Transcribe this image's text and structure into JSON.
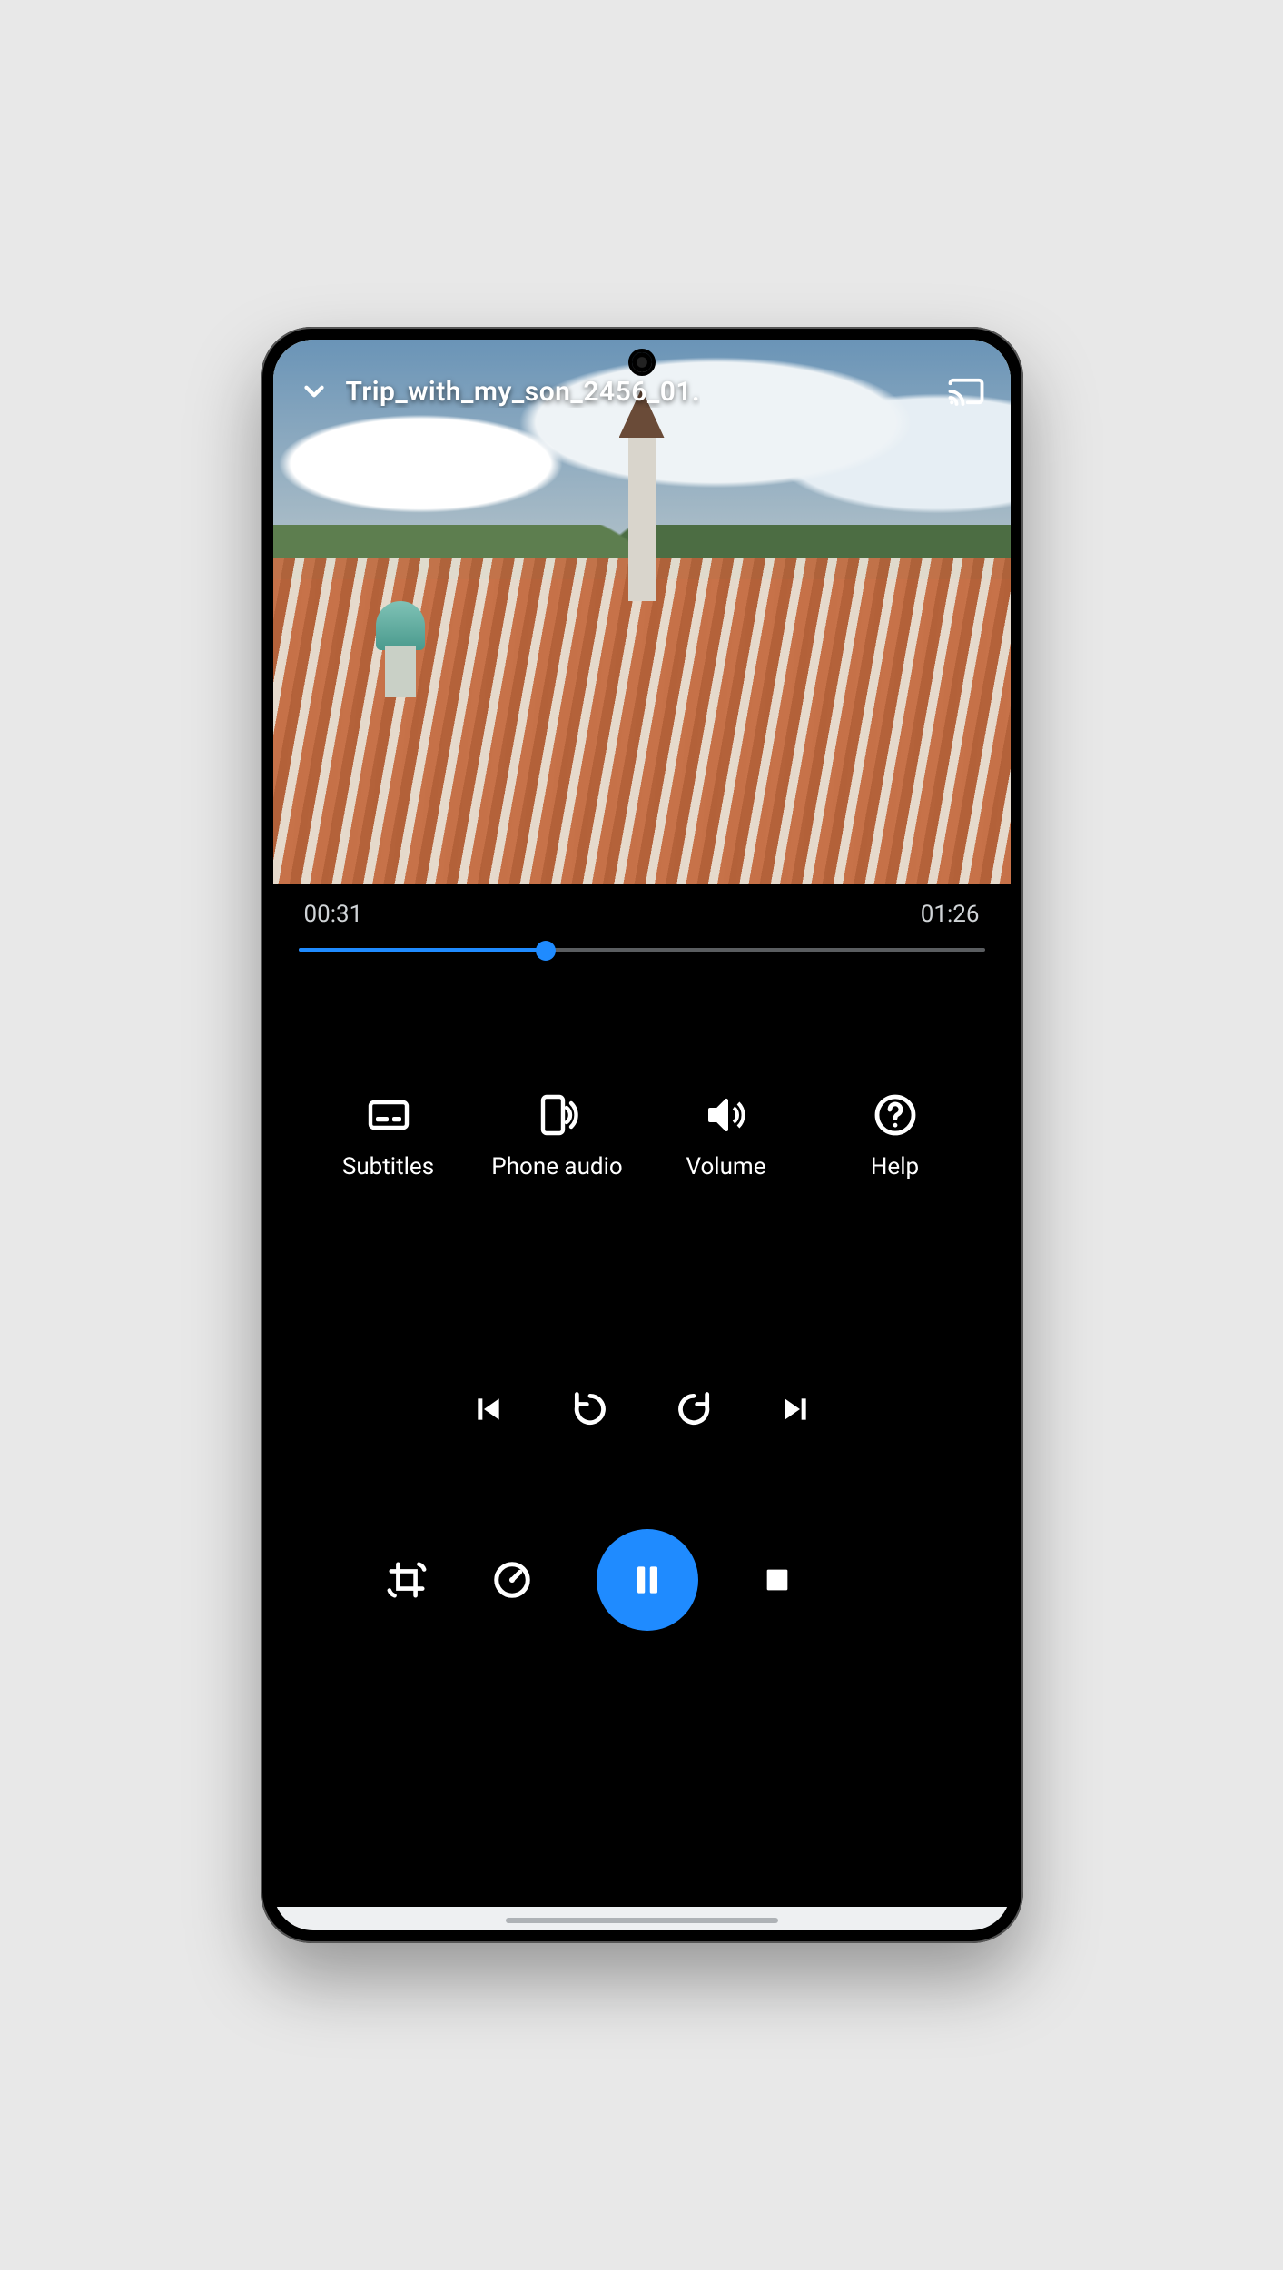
{
  "header": {
    "title": "Trip_with_my_son_2456_01.",
    "collapse_icon": "chevron-down-icon",
    "cast_icon": "cast-icon"
  },
  "playback": {
    "elapsed": "00:31",
    "duration": "01:26",
    "progress_percent": 36,
    "state": "playing"
  },
  "options": [
    {
      "icon": "subtitles-icon",
      "label": "Subtitles"
    },
    {
      "icon": "phone-audio-icon",
      "label": "Phone audio"
    },
    {
      "icon": "volume-icon",
      "label": "Volume"
    },
    {
      "icon": "help-icon",
      "label": "Help"
    }
  ],
  "transport": {
    "previous": "previous-icon",
    "rewind": "rewind-icon",
    "forward": "forward-icon",
    "next": "next-icon"
  },
  "bottom": {
    "rotate_crop": "rotate-crop-icon",
    "speed": "speedometer-icon",
    "primary": "pause-icon",
    "stop": "stop-icon"
  },
  "colors": {
    "accent": "#1f8bff",
    "background": "#000000",
    "text": "#ffffff"
  }
}
